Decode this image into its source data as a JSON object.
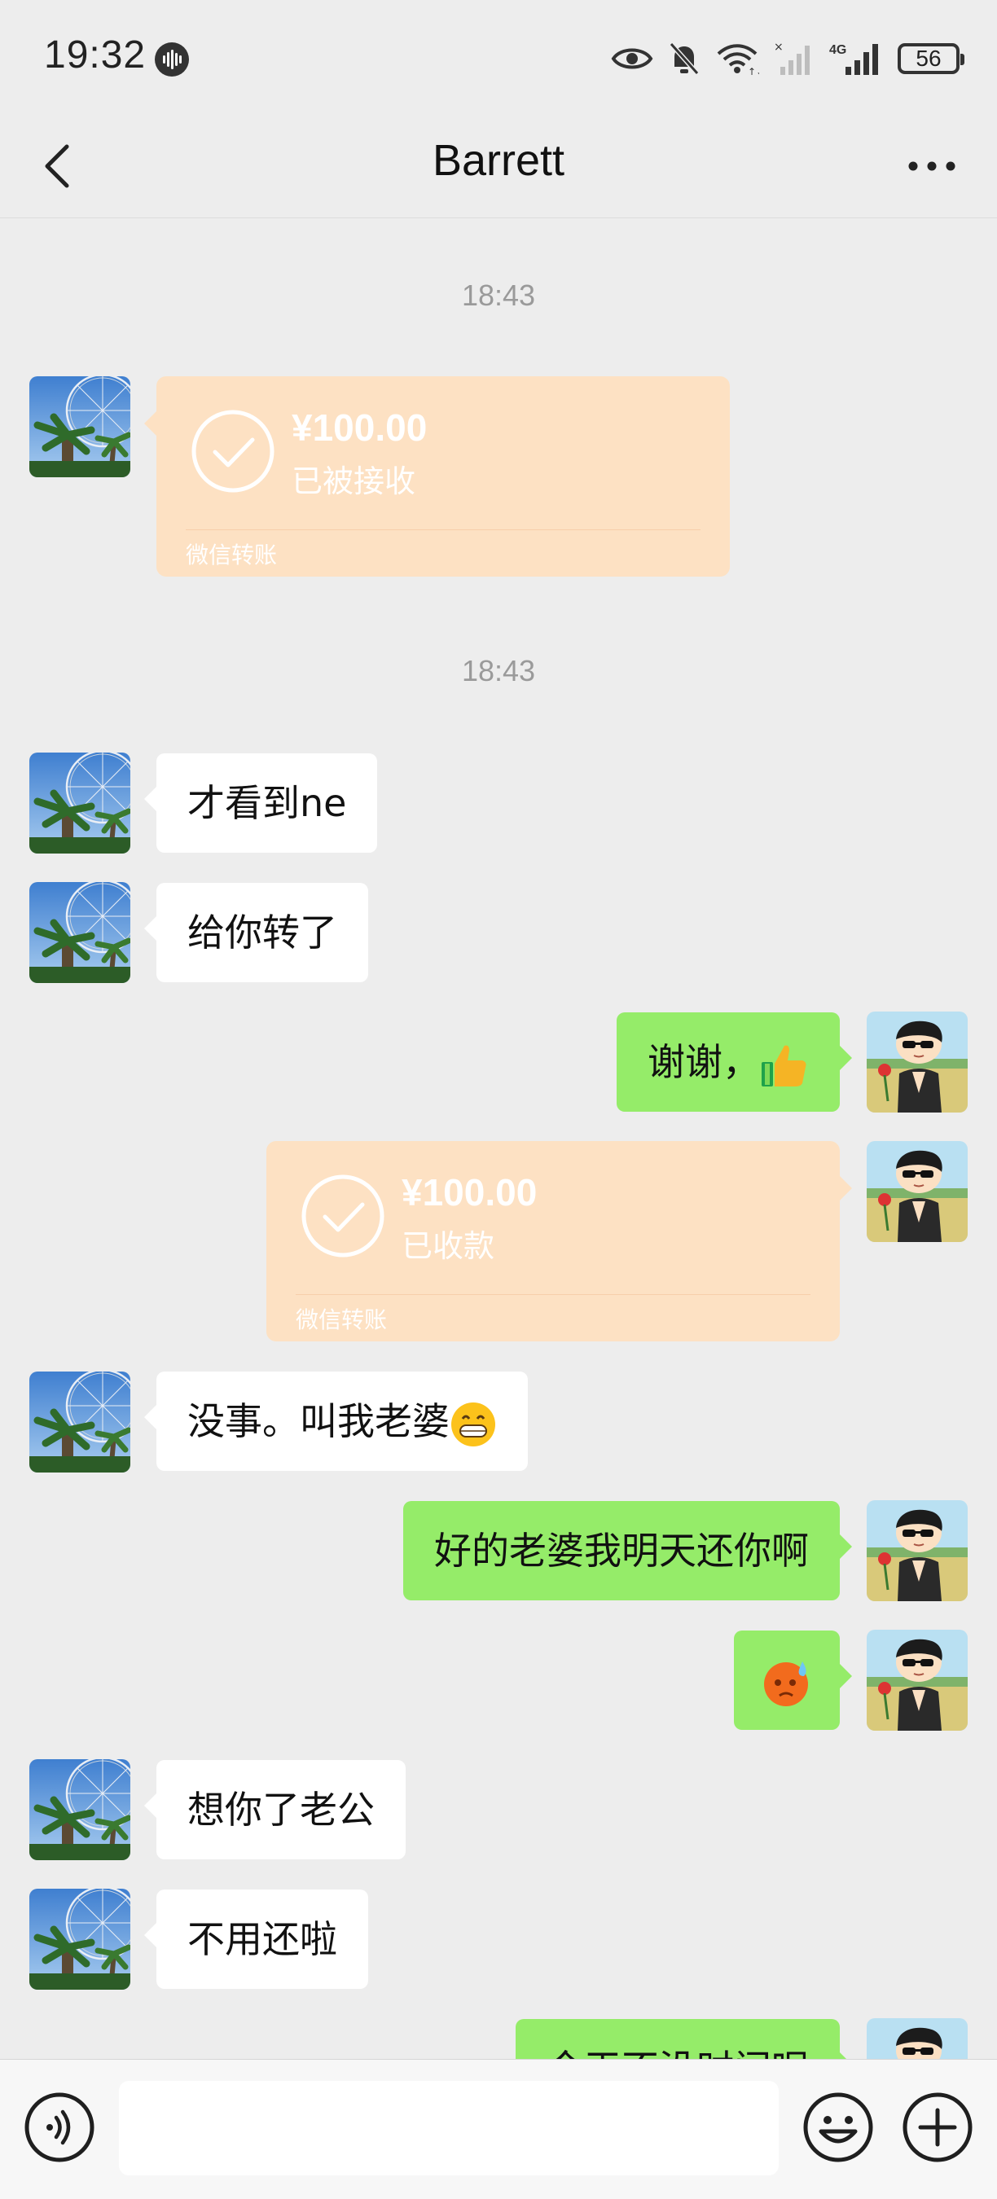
{
  "status_bar": {
    "time": "19:32",
    "battery": "56",
    "network": "4G",
    "icons": [
      "soundwave-icon",
      "eye-icon",
      "bell-off-icon",
      "wifi-icon",
      "signal-icon",
      "battery-icon"
    ]
  },
  "header": {
    "title": "Barrett",
    "back_icon": "chevron-left-icon",
    "more_icon": "more-dots-icon"
  },
  "messages": {
    "ts1": "18:43",
    "transfer1": {
      "amount": "¥100.00",
      "status": "已被接收",
      "brand": "微信转账"
    },
    "ts2": "18:43",
    "m1": "才看到ne",
    "m2": "给你转了",
    "m3": "谢谢，",
    "m3_emoji": "thumbs-up",
    "transfer2": {
      "amount": "¥100.00",
      "status": "已收款",
      "brand": "微信转账"
    },
    "m4": "没事。叫我老婆",
    "m4_emoji": "grinning-face",
    "m5": "好的老婆我明天还你啊",
    "m6_emoji": "sweat-face",
    "m7": "想你了老公",
    "m8": "不用还啦",
    "m9": "今天不没时间呢"
  },
  "input_bar": {
    "placeholder": "",
    "icons": [
      "voice-icon",
      "emoji-icon",
      "plus-icon"
    ]
  },
  "colors": {
    "background": "#ededed",
    "sent_bubble": "#95ec69",
    "received_bubble": "#ffffff",
    "transfer_card": "#fde1c3"
  }
}
